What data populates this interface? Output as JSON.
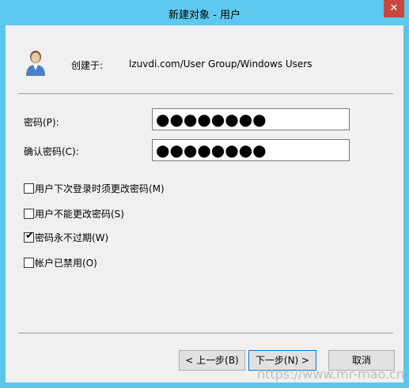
{
  "window": {
    "title": "新建对象 - 用户",
    "close_glyph": "✕"
  },
  "header": {
    "created_in_label": "创建于:",
    "created_in_path": "lzuvdi.com/User Group/Windows Users",
    "icon": "user-icon"
  },
  "form": {
    "password_label": "密码(P):",
    "password_value": "●●●●●●●●",
    "confirm_label": "确认密码(C):",
    "confirm_value": "●●●●●●●●"
  },
  "options": [
    {
      "label": "用户下次登录时须更改密码(M)",
      "checked": false
    },
    {
      "label": "用户不能更改密码(S)",
      "checked": false
    },
    {
      "label": "密码永不过期(W)",
      "checked": true
    },
    {
      "label": "帐户已禁用(O)",
      "checked": false
    }
  ],
  "buttons": {
    "back": "< 上一步(B)",
    "next": "下一步(N) >",
    "cancel": "取消"
  },
  "watermark": "https://www.mr-mao.cn"
}
